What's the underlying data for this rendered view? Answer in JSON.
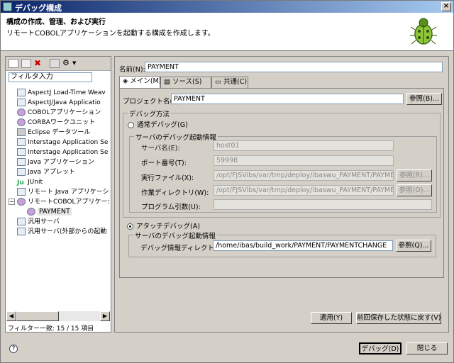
{
  "window": {
    "title": "デバッグ構成",
    "close": "×"
  },
  "header": {
    "title": "構成の作成、管理、および実行",
    "subtitle": "リモートCOBOLアプリケーションを起動する構成を作成します。"
  },
  "left": {
    "filter_placeholder": "フィルタ入力",
    "tree": [
      {
        "label": "AspectJ Load-Time Weav"
      },
      {
        "label": "AspectJ/Java Applicatio"
      },
      {
        "label": "COBOLアプリケーション"
      },
      {
        "label": "CORBAワークユニット"
      },
      {
        "label": "Eclipse データツール"
      },
      {
        "label": "Interstage Application Se"
      },
      {
        "label": "Interstage Application Se"
      },
      {
        "label": "Java アプリケーション"
      },
      {
        "label": "Java アプレット"
      },
      {
        "label": "JUnit"
      },
      {
        "label": "リモート Java アプリケーショ"
      },
      {
        "label": "リモートCOBOLアプリケーシ"
      },
      {
        "label": "PAYMENT"
      },
      {
        "label": "汎用サーバ"
      },
      {
        "label": "汎用サーバ(外部からの起動"
      }
    ],
    "status": "フィルター一致: 15 / 15 項目"
  },
  "right": {
    "name_label": "名前(N):",
    "name_value": "PAYMENT",
    "tabs": [
      {
        "label": "メイン(M)"
      },
      {
        "label": "ソース(S)"
      },
      {
        "label": "共通(C)"
      }
    ],
    "project_label": "プロジェクト名(P):",
    "project_value": "PAYMENT",
    "browse": "参照(B)...",
    "debug_method": "デバッグ方法",
    "normal_debug": "通常デバッグ(G)",
    "server_info": "サーバのデバッグ起動情報",
    "server_name_label": "サーバ名(E):",
    "server_name_value": "host01",
    "port_label": "ポート番号(T):",
    "port_value": "59998",
    "exe_label": "実行ファイル(X):",
    "exe_value": "/opt/FJSVibs/var/tmp/deploy/ibaswu_PAYMENT/PAYMEN",
    "exe_browse": "参照(R)...",
    "workdir_label": "作業ディレクトリ(W):",
    "workdir_value": "/opt/FJSVibs/var/tmp/deploy/ibaswu_PAYMENT/PAYMEN",
    "workdir_browse": "参照(O)...",
    "args_label": "プログラム引数(U):",
    "args_value": "",
    "attach_debug": "アタッチデバッグ(A)",
    "attach_info": "サーバのデバッグ起動情報",
    "debuginfo_label": "デバッグ情報ディレクトリ(F):",
    "debuginfo_value": "/home/ibas/build_work/PAYMENT/PAYMENTCHANGE",
    "debuginfo_browse": "参照(Q)...",
    "apply": "適用(Y)",
    "revert": "前回保存した状態に戻す(V)"
  },
  "footer": {
    "debug": "デバッグ(D)",
    "close": "閉じる",
    "help": "?"
  }
}
